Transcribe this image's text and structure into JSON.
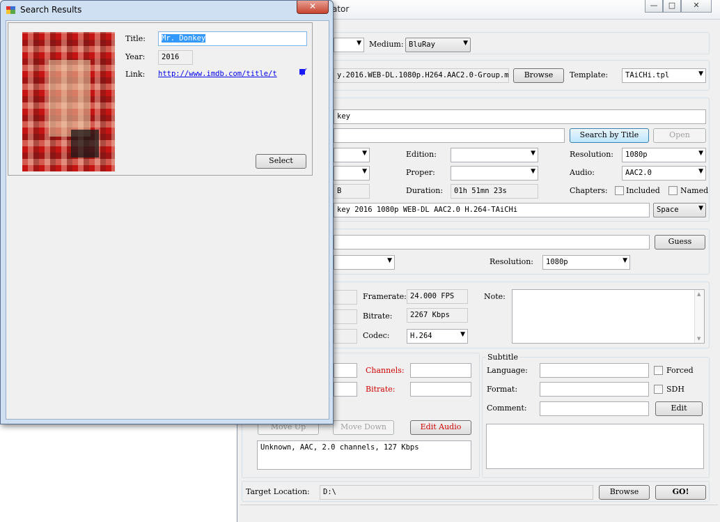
{
  "main_window": {
    "title_fragment": "ator",
    "medium_label": "Medium:",
    "medium_value": "BluRay",
    "file_path": "y.2016.WEB-DL.1080p.H264.AAC2.0-Group.mp4",
    "browse_label": "Browse",
    "template_label": "Template:",
    "template_value": "TAiCHi.tpl",
    "movie_title_value": "key",
    "search_by_title_label": "Search by Title",
    "open_label": "Open",
    "edition_label": "Edition:",
    "proper_label": "Proper:",
    "resolution_label": "Resolution:",
    "resolution_value": "1080p",
    "audio_label": "Audio:",
    "audio_value": "AAC2.0",
    "duration_label": "Duration:",
    "duration_value": "01h 51mn 23s",
    "size_value_fragment": "B",
    "chapters_label": "Chapters:",
    "included_label": "Included",
    "named_label": "Named",
    "release_name": "key 2016 1080p WEB-DL AAC2.0 H.264-TAiCHi",
    "separator_value": "Space",
    "guess_label": "Guess",
    "resolution2_label": "Resolution:",
    "resolution2_value": "1080p",
    "framerate_label": "Framerate:",
    "framerate_value": "24.000 FPS",
    "bitrate_label": "Bitrate:",
    "bitrate_value": "2267 Kbps",
    "codec_label": "Codec:",
    "codec_value": "H.264",
    "note_label": "Note:",
    "channels_label": "Channels:",
    "audio_bitrate_label": "Bitrate:",
    "move_up_label": "Move Up",
    "move_down_label": "Move Down",
    "edit_audio_label": "Edit Audio",
    "audio_list_item": "Unknown, AAC, 2.0 channels, 127 Kbps",
    "subtitle_group_label": "Subtitle",
    "language_label": "Language:",
    "forced_label": "Forced",
    "format_label": "Format:",
    "sdh_label": "SDH",
    "comment_label": "Comment:",
    "edit_label": "Edit",
    "target_location_label": "Target Location:",
    "target_location_value": "D:\\",
    "browse2_label": "Browse",
    "go_label": "GO!"
  },
  "search_dialog": {
    "title": "Search Results",
    "title_label": "Title:",
    "title_value": "Mr. Donkey",
    "year_label": "Year:",
    "year_value": "2016",
    "link_label": "Link:",
    "link_value": "http://www.imdb.com/title/t",
    "select_label": "Select"
  },
  "colors": {
    "accent_red": "#d00000",
    "link_blue": "#0000ee",
    "selection_blue": "#3399ff"
  }
}
